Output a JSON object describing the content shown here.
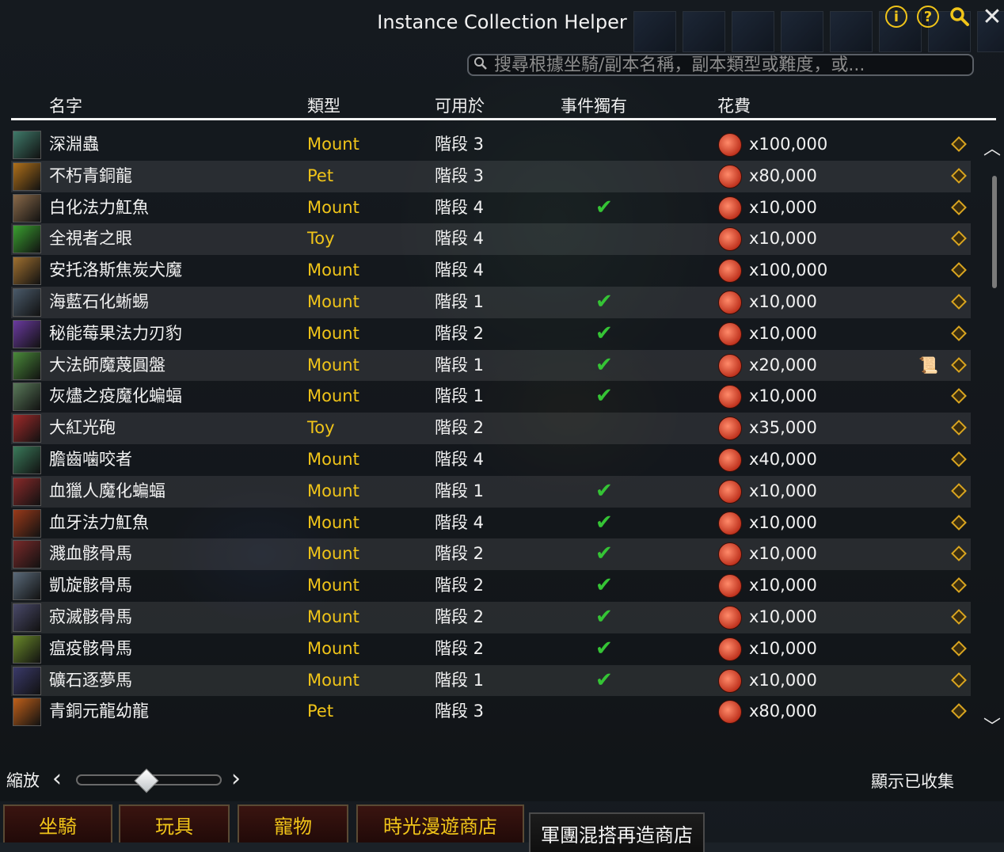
{
  "window": {
    "title": "Instance Collection Helper"
  },
  "header_icons": [
    {
      "name": "info-icon",
      "glyph": "i"
    },
    {
      "name": "help-icon",
      "glyph": "?"
    },
    {
      "name": "search-icon",
      "glyph": "⚲"
    },
    {
      "name": "close-icon",
      "glyph": "✕"
    }
  ],
  "search": {
    "placeholder": "搜尋根據坐騎/副本名稱，副本類型或難度，或..."
  },
  "columns": {
    "name": "名字",
    "type": "類型",
    "available": "可用於",
    "event": "事件獨有",
    "cost": "花費"
  },
  "rows": [
    {
      "name": "深淵蟲",
      "type": "Mount",
      "available": "階段 3",
      "event": false,
      "cost": "x100,000",
      "icon_color": "#3f7a6a"
    },
    {
      "name": "不朽青銅龍",
      "type": "Pet",
      "available": "階段 3",
      "event": false,
      "cost": "x80,000",
      "icon_color": "#b0701a"
    },
    {
      "name": "白化法力魟魚",
      "type": "Mount",
      "available": "階段 4",
      "event": true,
      "cost": "x10,000",
      "icon_color": "#8a6a4a"
    },
    {
      "name": "全視者之眼",
      "type": "Toy",
      "available": "階段 4",
      "event": false,
      "cost": "x10,000",
      "icon_color": "#3aa030"
    },
    {
      "name": "安托洛斯焦炭犬魔",
      "type": "Mount",
      "available": "階段 4",
      "event": false,
      "cost": "x100,000",
      "icon_color": "#a07030"
    },
    {
      "name": "海藍石化蜥蜴",
      "type": "Mount",
      "available": "階段 1",
      "event": true,
      "cost": "x10,000",
      "icon_color": "#4a5a6a"
    },
    {
      "name": "秘能莓果法力刃豹",
      "type": "Mount",
      "available": "階段 2",
      "event": true,
      "cost": "x10,000",
      "icon_color": "#6a3aa0"
    },
    {
      "name": "大法師魔蔑圓盤",
      "type": "Mount",
      "available": "階段 1",
      "event": true,
      "cost": "x20,000",
      "icon_color": "#4a8a3a",
      "note": true
    },
    {
      "name": "灰燼之疫魔化蝙蝠",
      "type": "Mount",
      "available": "階段 1",
      "event": true,
      "cost": "x10,000",
      "icon_color": "#5a7a5a"
    },
    {
      "name": "大紅光砲",
      "type": "Toy",
      "available": "階段 2",
      "event": false,
      "cost": "x35,000",
      "icon_color": "#a02a2a"
    },
    {
      "name": "膽齒噛咬者",
      "type": "Mount",
      "available": "階段 4",
      "event": false,
      "cost": "x40,000",
      "icon_color": "#3a7a5a"
    },
    {
      "name": "血獵人魔化蝙蝠",
      "type": "Mount",
      "available": "階段 1",
      "event": true,
      "cost": "x10,000",
      "icon_color": "#8a2a2a"
    },
    {
      "name": "血牙法力魟魚",
      "type": "Mount",
      "available": "階段 4",
      "event": true,
      "cost": "x10,000",
      "icon_color": "#9a3a1a"
    },
    {
      "name": "濺血骸骨馬",
      "type": "Mount",
      "available": "階段 2",
      "event": true,
      "cost": "x10,000",
      "icon_color": "#7a2a2a"
    },
    {
      "name": "凱旋骸骨馬",
      "type": "Mount",
      "available": "階段 2",
      "event": true,
      "cost": "x10,000",
      "icon_color": "#5a6a7a"
    },
    {
      "name": "寂滅骸骨馬",
      "type": "Mount",
      "available": "階段 2",
      "event": true,
      "cost": "x10,000",
      "icon_color": "#4a4a6a"
    },
    {
      "name": "瘟疫骸骨馬",
      "type": "Mount",
      "available": "階段 2",
      "event": true,
      "cost": "x10,000",
      "icon_color": "#6a8a2a"
    },
    {
      "name": "礦石逐夢馬",
      "type": "Mount",
      "available": "階段 1",
      "event": true,
      "cost": "x10,000",
      "icon_color": "#3a3a6a"
    },
    {
      "name": "青銅元龍幼龍",
      "type": "Pet",
      "available": "階段 3",
      "event": false,
      "cost": "x80,000",
      "icon_color": "#c0601a"
    }
  ],
  "footer": {
    "zoom_label": "縮放",
    "show_collected": "顯示已收集",
    "zoom_level": 0.5
  },
  "tabs": [
    {
      "label": "坐騎",
      "active": false
    },
    {
      "label": "玩具",
      "active": false
    },
    {
      "label": "寵物",
      "active": false
    },
    {
      "label": "時光漫遊商店",
      "active": false
    },
    {
      "label": "軍團混搭再造商店",
      "active": true
    }
  ],
  "colors": {
    "accent": "#f0c419",
    "check": "#35c435"
  }
}
